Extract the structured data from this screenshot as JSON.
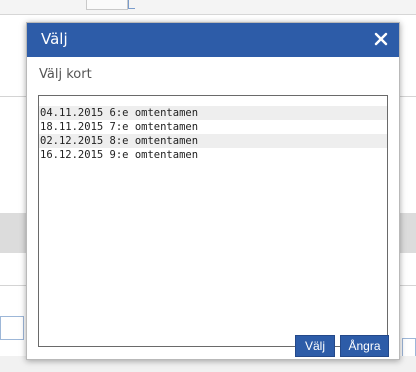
{
  "dialog": {
    "title": "Välj",
    "subtitle": "Välj kort",
    "close_icon": "close-icon",
    "items": [
      {
        "label": "04.11.2015 6:e omtentamen"
      },
      {
        "label": "18.11.2015 7:e omtentamen"
      },
      {
        "label": "02.12.2015 8:e omtentamen"
      },
      {
        "label": "16.12.2015 9:e omtentamen"
      }
    ],
    "buttons": {
      "select_label": "Välj",
      "cancel_label": "Ångra"
    }
  },
  "colors": {
    "accent": "#2d5ca8",
    "row_alt": "#eeeeee",
    "border": "#6a6a6a"
  }
}
